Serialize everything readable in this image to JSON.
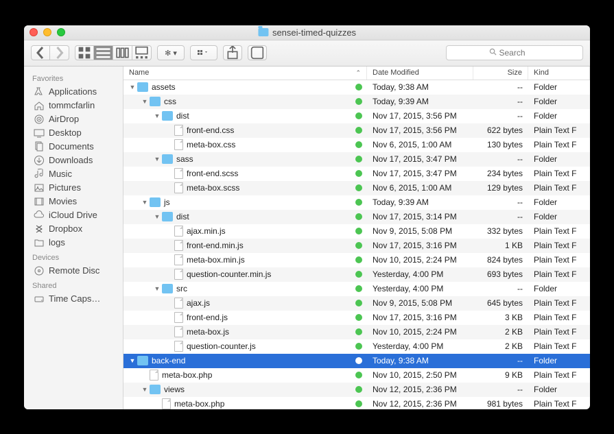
{
  "window_title": "sensei-timed-quizzes",
  "search_placeholder": "Search",
  "sidebar": {
    "sections": [
      {
        "title": "Favorites",
        "items": [
          {
            "label": "Applications",
            "icon": "apps"
          },
          {
            "label": "tommcfarlin",
            "icon": "home"
          },
          {
            "label": "AirDrop",
            "icon": "airdrop"
          },
          {
            "label": "Desktop",
            "icon": "desktop"
          },
          {
            "label": "Documents",
            "icon": "documents"
          },
          {
            "label": "Downloads",
            "icon": "downloads"
          },
          {
            "label": "Music",
            "icon": "music"
          },
          {
            "label": "Pictures",
            "icon": "pictures"
          },
          {
            "label": "Movies",
            "icon": "movies"
          },
          {
            "label": "iCloud Drive",
            "icon": "icloud"
          },
          {
            "label": "Dropbox",
            "icon": "dropbox"
          },
          {
            "label": "logs",
            "icon": "folder-gray"
          }
        ]
      },
      {
        "title": "Devices",
        "items": [
          {
            "label": "Remote Disc",
            "icon": "disc"
          }
        ]
      },
      {
        "title": "Shared",
        "items": [
          {
            "label": "Time Caps…",
            "icon": "drive"
          }
        ]
      }
    ]
  },
  "columns": {
    "name": "Name",
    "date": "Date Modified",
    "size": "Size",
    "kind": "Kind"
  },
  "rows": [
    {
      "depth": 0,
      "expanded": true,
      "type": "folder",
      "name": "assets",
      "date": "Today, 9:38 AM",
      "size": "--",
      "kind": "Folder"
    },
    {
      "depth": 1,
      "expanded": true,
      "type": "folder",
      "name": "css",
      "date": "Today, 9:39 AM",
      "size": "--",
      "kind": "Folder"
    },
    {
      "depth": 2,
      "expanded": true,
      "type": "folder",
      "name": "dist",
      "date": "Nov 17, 2015, 3:56 PM",
      "size": "--",
      "kind": "Folder"
    },
    {
      "depth": 3,
      "type": "file",
      "name": "front-end.css",
      "date": "Nov 17, 2015, 3:56 PM",
      "size": "622 bytes",
      "kind": "Plain Text F"
    },
    {
      "depth": 3,
      "type": "file",
      "name": "meta-box.css",
      "date": "Nov 6, 2015, 1:00 AM",
      "size": "130 bytes",
      "kind": "Plain Text F"
    },
    {
      "depth": 2,
      "expanded": true,
      "type": "folder",
      "name": "sass",
      "date": "Nov 17, 2015, 3:47 PM",
      "size": "--",
      "kind": "Folder"
    },
    {
      "depth": 3,
      "type": "file",
      "name": "front-end.scss",
      "date": "Nov 17, 2015, 3:47 PM",
      "size": "234 bytes",
      "kind": "Plain Text F"
    },
    {
      "depth": 3,
      "type": "file",
      "name": "meta-box.scss",
      "date": "Nov 6, 2015, 1:00 AM",
      "size": "129 bytes",
      "kind": "Plain Text F"
    },
    {
      "depth": 1,
      "expanded": true,
      "type": "folder",
      "name": "js",
      "date": "Today, 9:39 AM",
      "size": "--",
      "kind": "Folder"
    },
    {
      "depth": 2,
      "expanded": true,
      "type": "folder",
      "name": "dist",
      "date": "Nov 17, 2015, 3:14 PM",
      "size": "--",
      "kind": "Folder"
    },
    {
      "depth": 3,
      "type": "file",
      "name": "ajax.min.js",
      "date": "Nov 9, 2015, 5:08 PM",
      "size": "332 bytes",
      "kind": "Plain Text F"
    },
    {
      "depth": 3,
      "type": "file",
      "name": "front-end.min.js",
      "date": "Nov 17, 2015, 3:16 PM",
      "size": "1 KB",
      "kind": "Plain Text F"
    },
    {
      "depth": 3,
      "type": "file",
      "name": "meta-box.min.js",
      "date": "Nov 10, 2015, 2:24 PM",
      "size": "824 bytes",
      "kind": "Plain Text F"
    },
    {
      "depth": 3,
      "type": "file",
      "name": "question-counter.min.js",
      "date": "Yesterday, 4:00 PM",
      "size": "693 bytes",
      "kind": "Plain Text F"
    },
    {
      "depth": 2,
      "expanded": true,
      "type": "folder",
      "name": "src",
      "date": "Yesterday, 4:00 PM",
      "size": "--",
      "kind": "Folder"
    },
    {
      "depth": 3,
      "type": "file",
      "name": "ajax.js",
      "date": "Nov 9, 2015, 5:08 PM",
      "size": "645 bytes",
      "kind": "Plain Text F"
    },
    {
      "depth": 3,
      "type": "file",
      "name": "front-end.js",
      "date": "Nov 17, 2015, 3:16 PM",
      "size": "3 KB",
      "kind": "Plain Text F"
    },
    {
      "depth": 3,
      "type": "file",
      "name": "meta-box.js",
      "date": "Nov 10, 2015, 2:24 PM",
      "size": "2 KB",
      "kind": "Plain Text F"
    },
    {
      "depth": 3,
      "type": "file",
      "name": "question-counter.js",
      "date": "Yesterday, 4:00 PM",
      "size": "2 KB",
      "kind": "Plain Text F"
    },
    {
      "depth": 0,
      "expanded": true,
      "type": "folder",
      "name": "back-end",
      "date": "Today, 9:38 AM",
      "size": "--",
      "kind": "Folder",
      "selected": true
    },
    {
      "depth": 1,
      "type": "file",
      "name": "meta-box.php",
      "date": "Nov 10, 2015, 2:50 PM",
      "size": "9 KB",
      "kind": "Plain Text F"
    },
    {
      "depth": 1,
      "expanded": true,
      "type": "folder",
      "name": "views",
      "date": "Nov 12, 2015, 2:36 PM",
      "size": "--",
      "kind": "Folder"
    },
    {
      "depth": 2,
      "type": "file",
      "name": "meta-box.php",
      "date": "Nov 12, 2015, 2:36 PM",
      "size": "981 bytes",
      "kind": "Plain Text F"
    }
  ]
}
